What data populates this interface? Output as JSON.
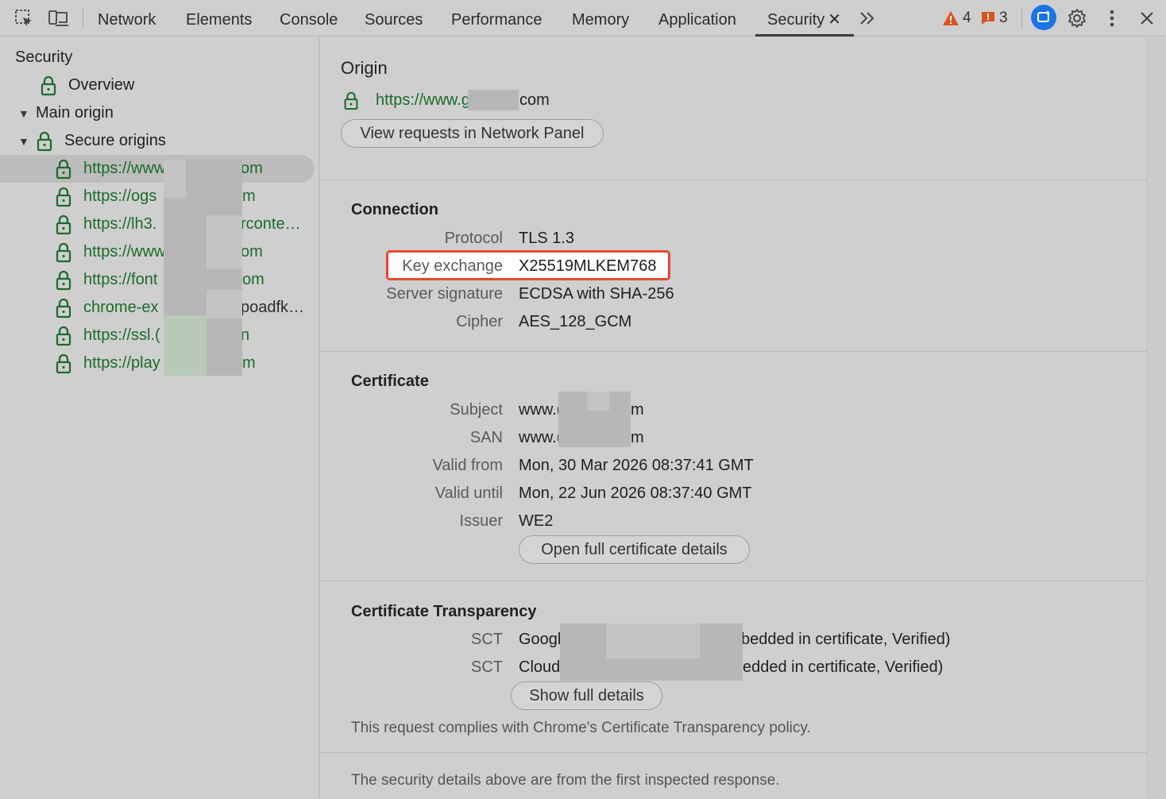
{
  "toolbar": {
    "tabs": [
      "Network",
      "Elements",
      "Console",
      "Sources",
      "Performance",
      "Memory",
      "Application",
      "Security"
    ],
    "active_tab": "Security",
    "warnings_count": "4",
    "issues_count": "3",
    "icons": [
      "inspect-element-icon",
      "device-toolbar-icon",
      "more-tabs-icon",
      "ai-assistant-icon",
      "settings-icon",
      "more-vert-icon",
      "close-icon"
    ]
  },
  "sidebar": {
    "title": "Security",
    "overview": "Overview",
    "main_origin": "Main origin",
    "secure_origins": "Secure origins",
    "origins": [
      {
        "left": "https://www",
        "right": "om"
      },
      {
        "left": "https://ogs",
        "right": "m"
      },
      {
        "left": "https://lh3.",
        "right": "rconte…"
      },
      {
        "left": "https://www",
        "right": "om"
      },
      {
        "left": "https://font",
        "right": "om"
      },
      {
        "left": "chrome-ex",
        "right": "poadfk…"
      },
      {
        "left": "https://ssl.(",
        "right": "n"
      },
      {
        "left": "https://play",
        "right": "m"
      }
    ]
  },
  "main": {
    "origin": {
      "heading": "Origin",
      "url_left": "https://www.g",
      "url_right": "com",
      "view_requests_button": "View requests in Network Panel"
    },
    "connection": {
      "heading": "Connection",
      "rows": [
        {
          "label": "Protocol",
          "value": "TLS 1.3"
        },
        {
          "label": "Key exchange",
          "value": "X25519MLKEM768"
        },
        {
          "label": "Server signature",
          "value": "ECDSA with SHA-256"
        },
        {
          "label": "Cipher",
          "value": "AES_128_GCM"
        }
      ]
    },
    "certificate": {
      "heading": "Certificate",
      "rows": [
        {
          "label": "Subject",
          "value_left": "www.(",
          "value_right": "m"
        },
        {
          "label": "SAN",
          "value_left": "www.(",
          "value_right": "m"
        },
        {
          "label": "Valid from",
          "value": "Mon, 30 Mar 2026 08:37:41 GMT"
        },
        {
          "label": "Valid until",
          "value": "Mon, 22 Jun 2026 08:37:40 GMT"
        },
        {
          "label": "Issuer",
          "value": "WE2"
        }
      ],
      "details_button": "Open full certificate details"
    },
    "transparency": {
      "heading": "Certificate Transparency",
      "rows": [
        {
          "label": "SCT",
          "value_left": "Googl",
          "value_right": "bedded in certificate, Verified)"
        },
        {
          "label": "SCT",
          "value_left": "Cloud",
          "value_right": "edded in certificate, Verified)"
        }
      ],
      "show_details_button": "Show full details",
      "compliance_note": "This request complies with Chrome's Certificate Transparency policy."
    },
    "footer_note": "The security details above are from the first inspected response."
  },
  "colors": {
    "secure_green": "#1a6b2a",
    "highlight_border": "#e34a2d",
    "warning_orange": "#d9541e",
    "ai_blue": "#1a73e8"
  }
}
